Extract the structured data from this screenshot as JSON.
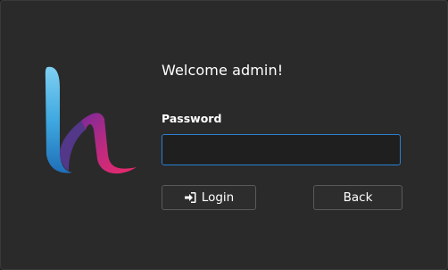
{
  "welcome_text": "Welcome admin!",
  "password": {
    "label": "Password",
    "value": ""
  },
  "buttons": {
    "login_label": "Login",
    "login_icon": "sign-in-icon",
    "back_label": "Back"
  },
  "colors": {
    "background": "#2a2a2a",
    "input_focus_border": "#2a7fd0",
    "logo_blue": "#3fa9e0",
    "logo_pink": "#e0286e",
    "logo_purple": "#6b3fa0"
  }
}
